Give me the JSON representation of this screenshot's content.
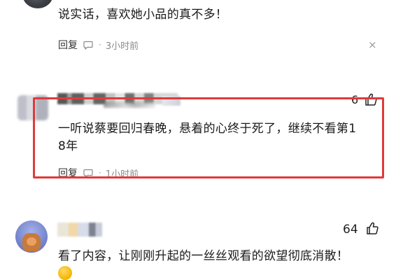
{
  "comments": [
    {
      "text": "说实话，喜欢她小品的真不多！",
      "reply_label": "回复",
      "separator": "·",
      "time": "3小时前",
      "close": "×"
    },
    {
      "text_line1": "一听说蔡要回归春晚，悬着的心终于死了，继续不看第1",
      "text_line2": "8年",
      "likes": "6",
      "reply_label": "回复",
      "separator": "·",
      "time": "1小时前",
      "highlight_color": "#e03a3a"
    },
    {
      "text": "看了内容，让刚刚升起的一丝丝观看的欲望彻底消散！",
      "likes": "64"
    }
  ],
  "icons": {
    "reply": "chat-bubble-icon",
    "like": "thumbs-up-icon",
    "close": "close-icon"
  }
}
